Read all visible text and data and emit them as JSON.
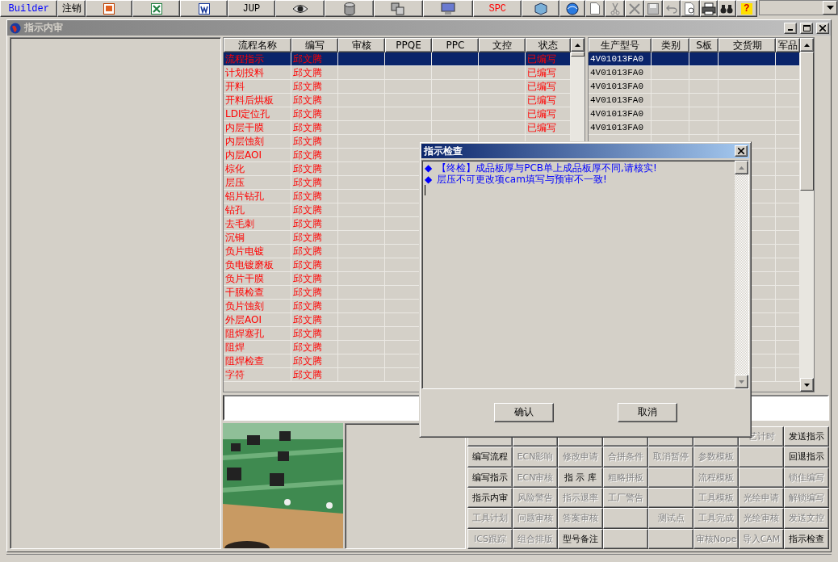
{
  "toolbar": {
    "texts": [
      {
        "label": "Builder",
        "color": "#0000ff"
      },
      {
        "label": "注销",
        "color": "#000000"
      },
      {
        "label": "JUP",
        "color": "#000000"
      },
      {
        "label": "SPC",
        "color": "#ff0000"
      }
    ],
    "help_glyph": "?"
  },
  "window": {
    "title": "指示内审"
  },
  "flow_table": {
    "columns": [
      "流程名称",
      "编写",
      "审核",
      "PPQE",
      "PPC",
      "文控",
      "状态"
    ],
    "rows": [
      {
        "step": "流程指示",
        "author": "邱文腾",
        "status": "已编写",
        "selected": true
      },
      {
        "step": "计划投料",
        "author": "邱文腾",
        "status": "已编写",
        "selected": false
      },
      {
        "step": "开料",
        "author": "邱文腾",
        "status": "已编写",
        "selected": false
      },
      {
        "step": "开料后烘板",
        "author": "邱文腾",
        "status": "已编写",
        "selected": false
      },
      {
        "step": "LDI定位孔",
        "author": "邱文腾",
        "status": "已编写",
        "selected": false
      },
      {
        "step": "内层干膜",
        "author": "邱文腾",
        "status": "已编写",
        "selected": false
      },
      {
        "step": "内层蚀刻",
        "author": "邱文腾",
        "selected": false
      },
      {
        "step": "内层AOI",
        "author": "邱文腾",
        "selected": false
      },
      {
        "step": "棕化",
        "author": "邱文腾",
        "selected": false
      },
      {
        "step": "层压",
        "author": "邱文腾",
        "selected": false
      },
      {
        "step": "铝片钻孔",
        "author": "邱文腾",
        "selected": false
      },
      {
        "step": "钻孔",
        "author": "邱文腾",
        "selected": false
      },
      {
        "step": "去毛刺",
        "author": "邱文腾",
        "selected": false
      },
      {
        "step": "沉铜",
        "author": "邱文腾",
        "selected": false
      },
      {
        "step": "负片电镀",
        "author": "邱文腾",
        "selected": false
      },
      {
        "step": "负电镀磨板",
        "author": "邱文腾",
        "selected": false
      },
      {
        "step": "负片干膜",
        "author": "邱文腾",
        "selected": false
      },
      {
        "step": "干膜检查",
        "author": "邱文腾",
        "selected": false
      },
      {
        "step": "负片蚀刻",
        "author": "邱文腾",
        "selected": false
      },
      {
        "step": "外层AOI",
        "author": "邱文腾",
        "selected": false
      },
      {
        "step": "阻焊塞孔",
        "author": "邱文腾",
        "selected": false
      },
      {
        "step": "阻焊",
        "author": "邱文腾",
        "selected": false
      },
      {
        "step": "阻焊检查",
        "author": "邱文腾",
        "selected": false
      },
      {
        "step": "字符",
        "author": "邱文腾",
        "selected": false
      }
    ]
  },
  "model_table": {
    "columns": [
      "生产型号",
      "类别",
      "S板",
      "交货期",
      "军品"
    ],
    "rows": [
      {
        "model": "4V01013FA0",
        "selected": true
      },
      {
        "model": "4V01013FA0",
        "selected": false
      },
      {
        "model": "4V01013FA0",
        "selected": false
      },
      {
        "model": "4V01013FA0",
        "selected": false
      },
      {
        "model": "4V01013FA0",
        "selected": false
      },
      {
        "model": "4V01013FA0",
        "selected": false
      }
    ]
  },
  "buttons": [
    {
      "kind": "blank"
    },
    {
      "kind": "blank"
    },
    {
      "kind": "blank"
    },
    {
      "kind": "blank"
    },
    {
      "kind": "blank"
    },
    {
      "kind": "blank"
    },
    {
      "kind": "command",
      "label": "艺计时",
      "disabled": true
    },
    {
      "kind": "command",
      "label": "发送指示",
      "disabled": false
    },
    {
      "kind": "command",
      "label": "编写流程",
      "disabled": false
    },
    {
      "kind": "command",
      "label": "ECN影响",
      "disabled": true
    },
    {
      "kind": "command",
      "label": "修改申请",
      "disabled": true
    },
    {
      "kind": "command",
      "label": "合拼条件",
      "disabled": true
    },
    {
      "kind": "command",
      "label": "取消暂停",
      "disabled": true
    },
    {
      "kind": "command",
      "label": "参数模板",
      "disabled": true
    },
    {
      "kind": "blank"
    },
    {
      "kind": "command",
      "label": "回退指示",
      "disabled": false
    },
    {
      "kind": "command",
      "label": "编写指示",
      "disabled": false
    },
    {
      "kind": "command",
      "label": "ECN审核",
      "disabled": true
    },
    {
      "kind": "command",
      "label": "指 示 库",
      "disabled": false
    },
    {
      "kind": "command",
      "label": "粗略拼板",
      "disabled": true
    },
    {
      "kind": "blank"
    },
    {
      "kind": "command",
      "label": "流程模板",
      "disabled": true
    },
    {
      "kind": "blank"
    },
    {
      "kind": "command",
      "label": "锁住编写",
      "disabled": true
    },
    {
      "kind": "command",
      "label": "指示内审",
      "disabled": false
    },
    {
      "kind": "command",
      "label": "风险警告",
      "disabled": true
    },
    {
      "kind": "command",
      "label": "指示退率",
      "disabled": true
    },
    {
      "kind": "command",
      "label": "工厂警告",
      "disabled": true
    },
    {
      "kind": "blank"
    },
    {
      "kind": "command",
      "label": "工具模板",
      "disabled": true
    },
    {
      "kind": "command",
      "label": "光绘申请",
      "disabled": true
    },
    {
      "kind": "command",
      "label": "解锁编写",
      "disabled": true
    },
    {
      "kind": "command",
      "label": "工具计划",
      "disabled": true
    },
    {
      "kind": "command",
      "label": "问题审核",
      "disabled": true
    },
    {
      "kind": "command",
      "label": "答案审核",
      "disabled": true
    },
    {
      "kind": "blank"
    },
    {
      "kind": "command",
      "label": "测试点",
      "disabled": true
    },
    {
      "kind": "command",
      "label": "工具完成",
      "disabled": true
    },
    {
      "kind": "command",
      "label": "光绘审核",
      "disabled": true
    },
    {
      "kind": "command",
      "label": "发送文控",
      "disabled": true
    },
    {
      "kind": "command",
      "label": "ICS跟踪",
      "disabled": true
    },
    {
      "kind": "command",
      "label": "组合排版",
      "disabled": true
    },
    {
      "kind": "command",
      "label": "型号备注",
      "disabled": false
    },
    {
      "kind": "blank"
    },
    {
      "kind": "blank"
    },
    {
      "kind": "command",
      "label": "审核Nope",
      "disabled": true
    },
    {
      "kind": "command",
      "label": "导入CAM",
      "disabled": true
    },
    {
      "kind": "command",
      "label": "指示检查",
      "disabled": false
    }
  ],
  "dialog": {
    "title": "指示检查",
    "messages": [
      {
        "bullet": "◆",
        "text": "【终检】成品板厚与PCB单上成品板厚不同,请核实!"
      },
      {
        "bullet": "◆",
        "text": "层压不可更改项cam填写与预审不一致!"
      }
    ],
    "buttons": [
      "确认",
      "取消"
    ]
  }
}
